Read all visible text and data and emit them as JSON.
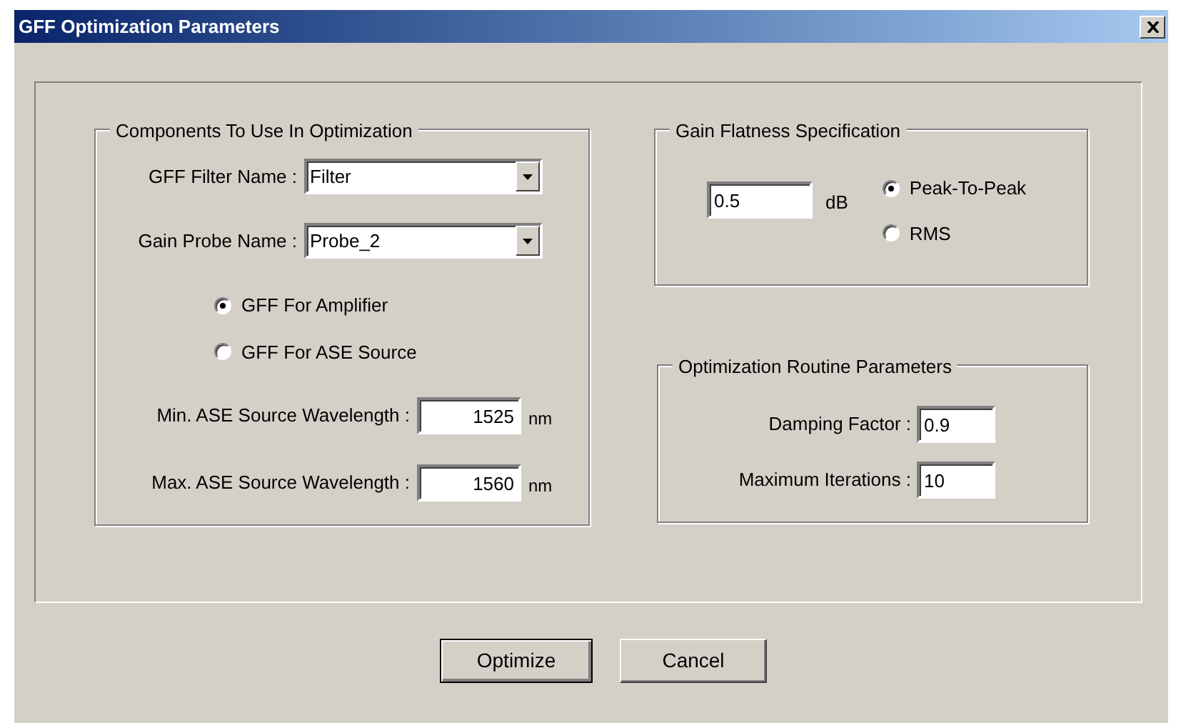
{
  "window": {
    "title": "GFF Optimization Parameters"
  },
  "components_group": {
    "title": "Components To Use In Optimization",
    "dropdowns": [
      {
        "label": "GFF Filter Name :",
        "value": "Filter"
      },
      {
        "label": "Gain Probe Name :",
        "value": "Probe_2"
      }
    ],
    "gff_mode": [
      {
        "label": "GFF For Amplifier",
        "selected": true
      },
      {
        "label": "GFF For ASE Source",
        "selected": false
      }
    ],
    "wavelengths": [
      {
        "label": "Min. ASE Source Wavelength :",
        "value": "1525",
        "unit": "nm"
      },
      {
        "label": "Max. ASE Source Wavelength :",
        "value": "1560",
        "unit": "nm"
      }
    ]
  },
  "gain_flatness": {
    "title": "Gain Flatness Specification",
    "value": "0.5",
    "unit": "dB",
    "measure": [
      {
        "label": "Peak-To-Peak",
        "selected": true
      },
      {
        "label": "RMS",
        "selected": false
      }
    ]
  },
  "routine": {
    "title": "Optimization Routine Parameters",
    "fields": [
      {
        "label": "Damping Factor :",
        "value": "0.9"
      },
      {
        "label": "Maximum Iterations :",
        "value": "10"
      }
    ]
  },
  "buttons": [
    {
      "label": "Optimize",
      "default": true
    },
    {
      "label": "Cancel",
      "default": false
    }
  ]
}
